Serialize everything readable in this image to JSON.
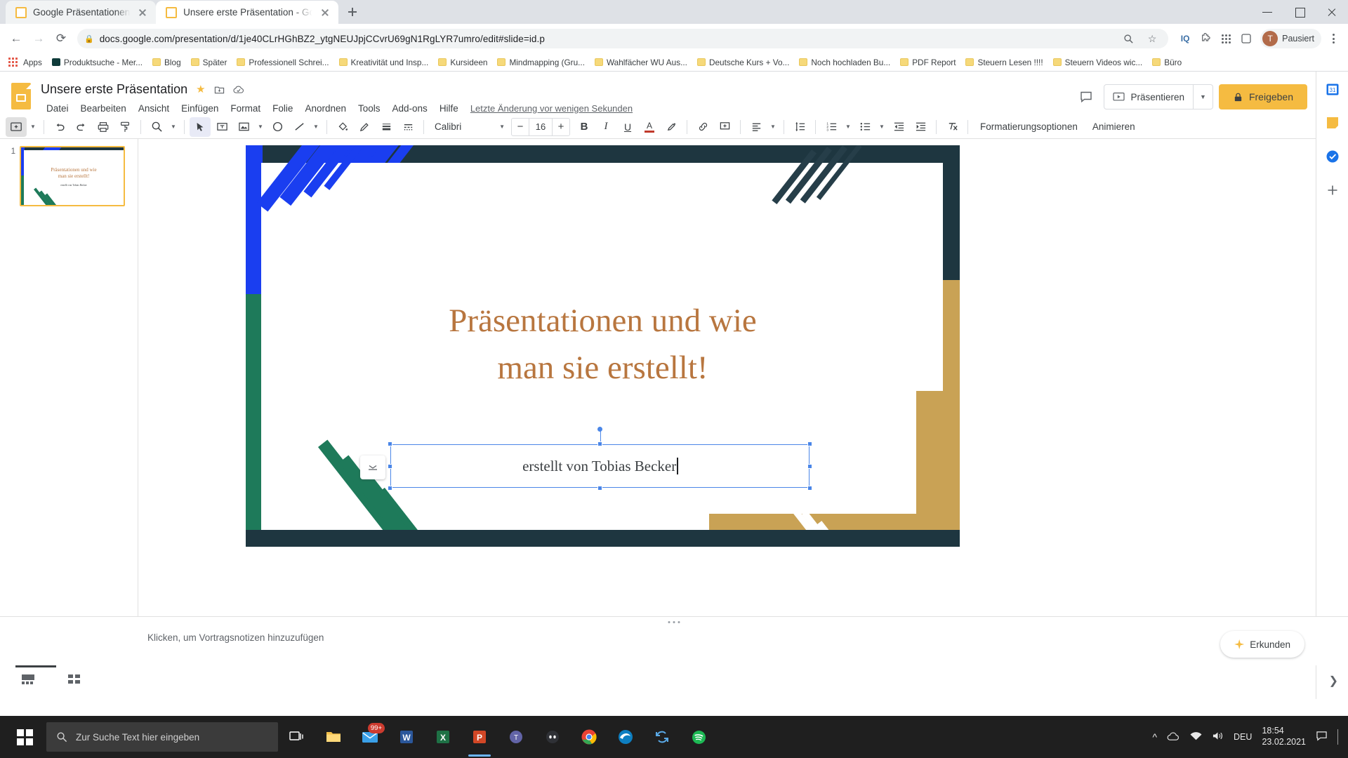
{
  "browser": {
    "tabs": [
      {
        "title": "Google Präsentationen",
        "active": false
      },
      {
        "title": "Unsere erste Präsentation - Goog",
        "active": true
      }
    ],
    "new_tab_label": "+",
    "nav": {
      "back": "←",
      "forward": "→",
      "reload": "⟳"
    },
    "omnibox": {
      "lock_icon": "lock-icon",
      "url": "docs.google.com/presentation/d/1je40CLrHGhBZ2_ytgNEUJpjCCvrU69gN1RgLYR7umro/edit#slide=id.p",
      "zoom_icon": "zoom-search-icon",
      "star_icon": "★"
    },
    "extensions": [
      "iq-extension-icon",
      "puzzle-extension-icon",
      "apps-grid-icon",
      "extension-icon"
    ],
    "profile": {
      "initial": "T",
      "label": "Pausiert"
    },
    "menu_icon": "three-dots-menu-icon",
    "window_controls": {
      "minimize": "minimize-icon",
      "maximize": "maximize-icon",
      "close": "close-icon"
    },
    "bookmarks": [
      {
        "label": "Apps",
        "icon": "apps-grid"
      },
      {
        "label": "Produktsuche - Mer...",
        "icon": "slides"
      },
      {
        "label": "Blog",
        "icon": "folder"
      },
      {
        "label": "Später",
        "icon": "folder"
      },
      {
        "label": "Professionell Schrei...",
        "icon": "folder"
      },
      {
        "label": "Kreativität und Insp...",
        "icon": "folder"
      },
      {
        "label": "Kursideen",
        "icon": "folder"
      },
      {
        "label": "Mindmapping  (Gru...",
        "icon": "folder"
      },
      {
        "label": "Wahlfächer WU Aus...",
        "icon": "folder"
      },
      {
        "label": "Deutsche Kurs + Vo...",
        "icon": "folder"
      },
      {
        "label": "Noch hochladen Bu...",
        "icon": "folder"
      },
      {
        "label": "PDF Report",
        "icon": "folder"
      },
      {
        "label": "Steuern Lesen !!!!",
        "icon": "folder"
      },
      {
        "label": "Steuern Videos wic...",
        "icon": "folder"
      },
      {
        "label": "Büro",
        "icon": "folder"
      }
    ]
  },
  "slides": {
    "doc_title": "Unsere erste Präsentation",
    "header_icons": [
      "star-icon",
      "move-to-folder-icon",
      "cloud-saved-icon"
    ],
    "menus": [
      "Datei",
      "Bearbeiten",
      "Ansicht",
      "Einfügen",
      "Format",
      "Folie",
      "Anordnen",
      "Tools",
      "Add-ons",
      "Hilfe"
    ],
    "last_edit": "Letzte Änderung vor wenigen Sekunden",
    "comment_icon": "comment-icon",
    "present_label": "Präsentieren",
    "present_caret": "▾",
    "share_label": "Freigeben",
    "share_icon": "lock-icon",
    "share_color": "#f5bb41",
    "toolbar": {
      "font_name": "Calibri",
      "font_size": "16",
      "decrease_label": "−",
      "increase_label": "+",
      "bold": "B",
      "italic": "I",
      "underline": "U",
      "text_color": "A",
      "highlight_icon": "highlight-icon",
      "link_icon": "link-icon",
      "image_icon": "insert-image-icon",
      "align_icon": "align-icon",
      "line_spacing_icon": "line-spacing-icon",
      "numbered_list_icon": "numbered-list-icon",
      "bulleted_list_icon": "bulleted-list-icon",
      "outdent_icon": "outdent-icon",
      "indent_icon": "indent-icon",
      "clear_format_icon": "clear-formatting-icon",
      "format_options_label": "Formatierungsoptionen",
      "animate_label": "Animieren",
      "collapse_icon": "collapse-toolbar-icon",
      "new_slide_icon": "new-slide-icon",
      "undo_icon": "undo-icon",
      "redo_icon": "redo-icon",
      "print_icon": "print-icon",
      "paint_format_icon": "paint-format-icon",
      "zoom_icon": "zoom-icon",
      "select_icon": "select-cursor-icon",
      "textbox_icon": "text-box-icon",
      "shape_icon": "shape-icon",
      "line_icon": "line-icon",
      "fill_icon": "fill-color-icon",
      "border_color_icon": "border-color-icon",
      "border_weight_icon": "border-weight-icon",
      "border_dash_icon": "border-dash-icon"
    },
    "filmstrip": {
      "slide_number": "1"
    },
    "slide": {
      "title_line1": "Präsentationen und wie",
      "title_line2": "man sie erstellt!",
      "subtitle": "erstellt von Tobias Becker",
      "title_color": "#b8763f",
      "bg_color": "#1e3640",
      "accent_blue": "#1a3ef0",
      "accent_green": "#1e7a5a",
      "accent_gold": "#c9a255",
      "selection_color": "#4a86e8",
      "float_button_icon": "crop-overflow-icon"
    },
    "notes_placeholder": "Klicken, um Vortragsnotizen hinzuzufügen",
    "explore_label": "Erkunden",
    "right_rail": [
      "calendar-icon",
      "keep-icon",
      "tasks-icon",
      "add-addon-icon",
      "expand-panel-icon"
    ],
    "bottom_bar": {
      "grid_view_icon": "grid-view-icon",
      "filmstrip_view_icon": "filmstrip-view-icon",
      "expand_icon": "expand-icon"
    }
  },
  "taskbar": {
    "start_icon": "windows-start-icon",
    "search_placeholder": "Zur Suche Text hier eingeben",
    "search_icon": "search-icon",
    "items": [
      {
        "name": "task-view-icon",
        "glyph": "❒",
        "color": "#ffffff",
        "badge": ""
      },
      {
        "name": "file-explorer-icon",
        "glyph": "📁",
        "color": "#f3c04a",
        "badge": ""
      },
      {
        "name": "mail-icon",
        "glyph": "✉",
        "color": "#3aa0e8",
        "badge": "99+"
      },
      {
        "name": "word-icon",
        "glyph": "W",
        "color": "#2b579a",
        "badge": ""
      },
      {
        "name": "excel-icon",
        "glyph": "X",
        "color": "#1e7145",
        "badge": ""
      },
      {
        "name": "powerpoint-icon",
        "glyph": "P",
        "color": "#d24726",
        "badge": ""
      },
      {
        "name": "teams-icon",
        "glyph": "◉",
        "color": "#6264a7",
        "badge": ""
      },
      {
        "name": "discord-icon",
        "glyph": "◍",
        "color": "#5865f2",
        "badge": ""
      },
      {
        "name": "chrome-icon",
        "glyph": "◎",
        "color": "#4285f4",
        "badge": ""
      },
      {
        "name": "edge-icon",
        "glyph": "◯",
        "color": "#0e7fc1",
        "badge": ""
      },
      {
        "name": "sync-icon",
        "glyph": "⇅",
        "color": "#5aa9e6",
        "badge": ""
      },
      {
        "name": "spotify-icon",
        "glyph": "♫",
        "color": "#1db954",
        "badge": ""
      }
    ],
    "tray": {
      "chevron": "^",
      "cloud_icon": "onedrive-icon",
      "network_icon": "network-icon",
      "volume_icon": "volume-icon",
      "language": "DEU",
      "time": "18:54",
      "date": "23.02.2021",
      "notification_icon": "notification-icon"
    }
  }
}
